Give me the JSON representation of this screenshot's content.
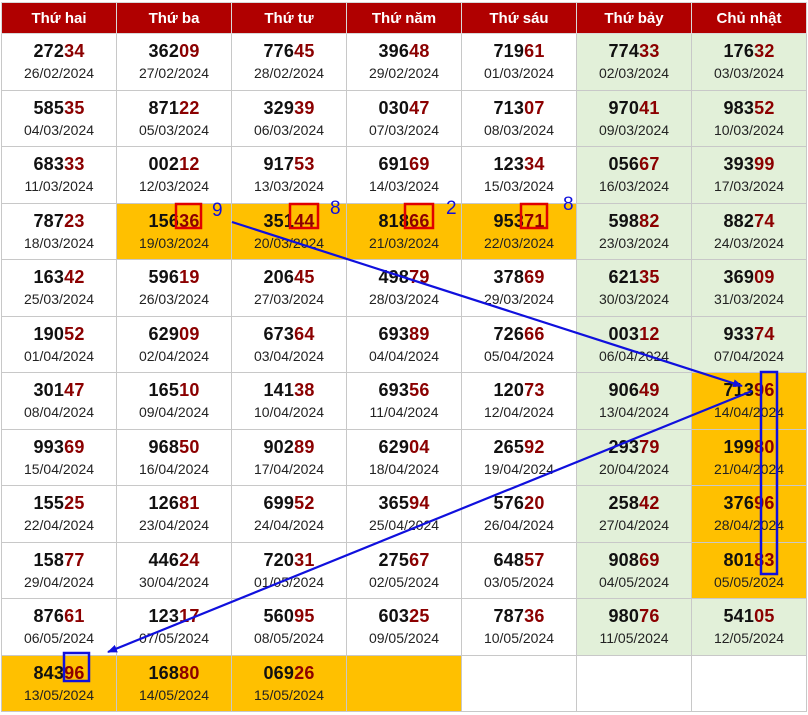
{
  "headers": [
    "Thứ hai",
    "Thứ ba",
    "Thứ tư",
    "Thứ năm",
    "Thứ sáu",
    "Thứ bảy",
    "Chủ nhật"
  ],
  "rows": [
    [
      {
        "pre": "272",
        "suf": "34",
        "date": "26/02/2024"
      },
      {
        "pre": "362",
        "suf": "09",
        "date": "27/02/2024"
      },
      {
        "pre": "776",
        "suf": "45",
        "date": "28/02/2024"
      },
      {
        "pre": "396",
        "suf": "48",
        "date": "29/02/2024"
      },
      {
        "pre": "719",
        "suf": "61",
        "date": "01/03/2024"
      },
      {
        "pre": "774",
        "suf": "33",
        "date": "02/03/2024"
      },
      {
        "pre": "176",
        "suf": "32",
        "date": "03/03/2024"
      }
    ],
    [
      {
        "pre": "585",
        "suf": "35",
        "date": "04/03/2024"
      },
      {
        "pre": "871",
        "suf": "22",
        "date": "05/03/2024"
      },
      {
        "pre": "329",
        "suf": "39",
        "date": "06/03/2024"
      },
      {
        "pre": "030",
        "suf": "47",
        "date": "07/03/2024"
      },
      {
        "pre": "713",
        "suf": "07",
        "date": "08/03/2024"
      },
      {
        "pre": "970",
        "suf": "41",
        "date": "09/03/2024"
      },
      {
        "pre": "983",
        "suf": "52",
        "date": "10/03/2024"
      }
    ],
    [
      {
        "pre": "683",
        "suf": "33",
        "date": "11/03/2024"
      },
      {
        "pre": "002",
        "suf": "12",
        "date": "12/03/2024"
      },
      {
        "pre": "917",
        "suf": "53",
        "date": "13/03/2024"
      },
      {
        "pre": "691",
        "suf": "69",
        "date": "14/03/2024"
      },
      {
        "pre": "123",
        "suf": "34",
        "date": "15/03/2024"
      },
      {
        "pre": "056",
        "suf": "67",
        "date": "16/03/2024"
      },
      {
        "pre": "393",
        "suf": "99",
        "date": "17/03/2024"
      }
    ],
    [
      {
        "pre": "787",
        "suf": "23",
        "date": "18/03/2024"
      },
      {
        "pre": "156",
        "suf": "36",
        "date": "19/03/2024",
        "hl": true
      },
      {
        "pre": "351",
        "suf": "44",
        "date": "20/03/2024",
        "hl": true
      },
      {
        "pre": "818",
        "suf": "66",
        "date": "21/03/2024",
        "hl": true
      },
      {
        "pre": "953",
        "suf": "71",
        "date": "22/03/2024",
        "hl": true
      },
      {
        "pre": "598",
        "suf": "82",
        "date": "23/03/2024"
      },
      {
        "pre": "882",
        "suf": "74",
        "date": "24/03/2024"
      }
    ],
    [
      {
        "pre": "163",
        "suf": "42",
        "date": "25/03/2024"
      },
      {
        "pre": "596",
        "suf": "19",
        "date": "26/03/2024"
      },
      {
        "pre": "206",
        "suf": "45",
        "date": "27/03/2024"
      },
      {
        "pre": "498",
        "suf": "79",
        "date": "28/03/2024"
      },
      {
        "pre": "378",
        "suf": "69",
        "date": "29/03/2024"
      },
      {
        "pre": "621",
        "suf": "35",
        "date": "30/03/2024"
      },
      {
        "pre": "369",
        "suf": "09",
        "date": "31/03/2024"
      }
    ],
    [
      {
        "pre": "190",
        "suf": "52",
        "date": "01/04/2024"
      },
      {
        "pre": "629",
        "suf": "09",
        "date": "02/04/2024"
      },
      {
        "pre": "673",
        "suf": "64",
        "date": "03/04/2024"
      },
      {
        "pre": "693",
        "suf": "89",
        "date": "04/04/2024"
      },
      {
        "pre": "726",
        "suf": "66",
        "date": "05/04/2024"
      },
      {
        "pre": "003",
        "suf": "12",
        "date": "06/04/2024"
      },
      {
        "pre": "933",
        "suf": "74",
        "date": "07/04/2024"
      }
    ],
    [
      {
        "pre": "301",
        "suf": "47",
        "date": "08/04/2024"
      },
      {
        "pre": "165",
        "suf": "10",
        "date": "09/04/2024"
      },
      {
        "pre": "141",
        "suf": "38",
        "date": "10/04/2024"
      },
      {
        "pre": "693",
        "suf": "56",
        "date": "11/04/2024"
      },
      {
        "pre": "120",
        "suf": "73",
        "date": "12/04/2024"
      },
      {
        "pre": "906",
        "suf": "49",
        "date": "13/04/2024"
      },
      {
        "pre": "713",
        "suf": "96",
        "date": "14/04/2024",
        "hl": true
      }
    ],
    [
      {
        "pre": "993",
        "suf": "69",
        "date": "15/04/2024"
      },
      {
        "pre": "968",
        "suf": "50",
        "date": "16/04/2024"
      },
      {
        "pre": "902",
        "suf": "89",
        "date": "17/04/2024"
      },
      {
        "pre": "629",
        "suf": "04",
        "date": "18/04/2024"
      },
      {
        "pre": "265",
        "suf": "92",
        "date": "19/04/2024"
      },
      {
        "pre": "293",
        "suf": "79",
        "date": "20/04/2024"
      },
      {
        "pre": "199",
        "suf": "80",
        "date": "21/04/2024",
        "hl": true
      }
    ],
    [
      {
        "pre": "155",
        "suf": "25",
        "date": "22/04/2024"
      },
      {
        "pre": "126",
        "suf": "81",
        "date": "23/04/2024"
      },
      {
        "pre": "699",
        "suf": "52",
        "date": "24/04/2024"
      },
      {
        "pre": "365",
        "suf": "94",
        "date": "25/04/2024"
      },
      {
        "pre": "576",
        "suf": "20",
        "date": "26/04/2024"
      },
      {
        "pre": "258",
        "suf": "42",
        "date": "27/04/2024"
      },
      {
        "pre": "376",
        "suf": "96",
        "date": "28/04/2024",
        "hl": true
      }
    ],
    [
      {
        "pre": "158",
        "suf": "77",
        "date": "29/04/2024"
      },
      {
        "pre": "446",
        "suf": "24",
        "date": "30/04/2024"
      },
      {
        "pre": "720",
        "suf": "31",
        "date": "01/05/2024"
      },
      {
        "pre": "275",
        "suf": "67",
        "date": "02/05/2024"
      },
      {
        "pre": "648",
        "suf": "57",
        "date": "03/05/2024"
      },
      {
        "pre": "908",
        "suf": "69",
        "date": "04/05/2024"
      },
      {
        "pre": "801",
        "suf": "83",
        "date": "05/05/2024",
        "hl": true
      }
    ],
    [
      {
        "pre": "876",
        "suf": "61",
        "date": "06/05/2024"
      },
      {
        "pre": "123",
        "suf": "17",
        "date": "07/05/2024"
      },
      {
        "pre": "560",
        "suf": "95",
        "date": "08/05/2024"
      },
      {
        "pre": "603",
        "suf": "25",
        "date": "09/05/2024"
      },
      {
        "pre": "787",
        "suf": "36",
        "date": "10/05/2024"
      },
      {
        "pre": "980",
        "suf": "76",
        "date": "11/05/2024"
      },
      {
        "pre": "541",
        "suf": "05",
        "date": "12/05/2024"
      }
    ],
    [
      {
        "pre": "843",
        "suf": "96",
        "date": "13/05/2024",
        "hl": true
      },
      {
        "pre": "168",
        "suf": "80",
        "date": "14/05/2024",
        "hl": true
      },
      {
        "pre": "069",
        "suf": "26",
        "date": "15/05/2024",
        "hl": true
      },
      {
        "empty": true,
        "hl": true
      },
      {
        "empty": true
      },
      {
        "empty": true
      },
      {
        "empty": true
      }
    ]
  ],
  "annotations": {
    "labels": [
      "9",
      "8",
      "2",
      "8"
    ],
    "colors": {
      "header_bg": "#b00000",
      "highlight": "#ffc000",
      "weekend": "#e2f0d9",
      "suffix": "#8b0000",
      "box_red": "#e00000",
      "box_blue": "#1010dd"
    }
  }
}
